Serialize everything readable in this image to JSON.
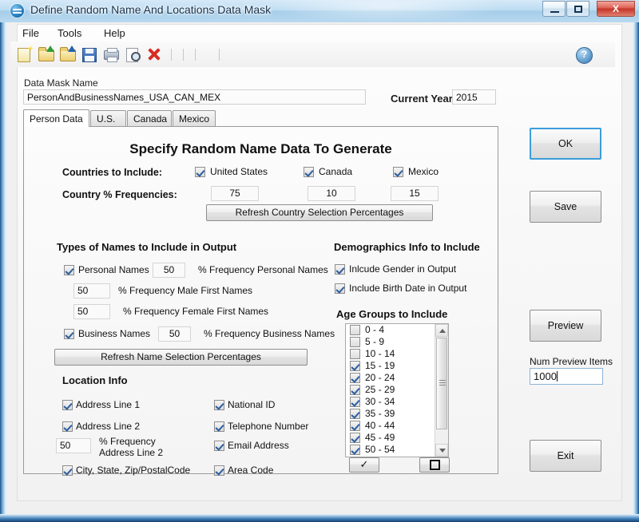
{
  "window": {
    "title": "Define Random Name And Locations Data Mask",
    "app_icon": "app-globe-icon",
    "minimize_label": "Minimize",
    "maximize_label": "Maximize",
    "close_label": "X"
  },
  "menu": [
    {
      "label": "File"
    },
    {
      "label": "Tools"
    },
    {
      "label": "Help"
    }
  ],
  "toolbar": {
    "icons": [
      {
        "name": "new-document-icon"
      },
      {
        "name": "open-folder-icon"
      },
      {
        "name": "save-as-folder-icon"
      },
      {
        "name": "save-floppy-icon"
      },
      {
        "name": "print-icon"
      },
      {
        "name": "print-preview-icon"
      },
      {
        "name": "delete-icon"
      }
    ],
    "help_glyph": "?"
  },
  "form": {
    "data_mask_name_label": "Data Mask Name",
    "data_mask_name_value": "PersonAndBusinessNames_USA_CAN_MEX",
    "current_year_label": "Current Year",
    "current_year_value": "2015"
  },
  "tabs": [
    {
      "label": "Person Data",
      "active": true
    },
    {
      "label": "U.S.",
      "active": false
    },
    {
      "label": "Canada",
      "active": false
    },
    {
      "label": "Mexico",
      "active": false
    }
  ],
  "panel": {
    "title": "Specify Random Name Data To Generate",
    "countries_label": "Countries to Include:",
    "countries": [
      {
        "label": "United States",
        "checked": true,
        "pct": "75"
      },
      {
        "label": "Canada",
        "checked": true,
        "pct": "10"
      },
      {
        "label": "Mexico",
        "checked": true,
        "pct": "15"
      }
    ],
    "frequencies_label": "Country % Frequencies:",
    "refresh_country_button": "Refresh Country Selection Percentages",
    "types_of_names_heading": "Types of Names  to Include in Output",
    "personal_names_label": "Personal Names",
    "personal_names_checked": true,
    "personal_names_pct": "50",
    "personal_names_pct_label": "% Frequency Personal Names",
    "male_pct": "50",
    "male_pct_label": "% Frequency Male First Names",
    "female_pct": "50",
    "female_pct_label": "% Frequency Female First Names",
    "business_names_label": "Business Names",
    "business_names_checked": true,
    "business_names_pct": "50",
    "business_names_pct_label": "% Frequency Business Names",
    "refresh_name_button": "Refresh Name Selection Percentages",
    "location_info_heading": "Location  Info",
    "location_left": [
      {
        "label": "Address Line 1",
        "checked": true
      },
      {
        "label": "Address Line 2",
        "checked": true
      },
      {
        "label": "City, State, Zip/PostalCode",
        "checked": true
      }
    ],
    "location_right": [
      {
        "label": "National ID",
        "checked": true
      },
      {
        "label": "Telephone Number",
        "checked": true
      },
      {
        "label": "Email Address",
        "checked": true
      },
      {
        "label": "Area Code",
        "checked": true
      }
    ],
    "address_line2_pct": "50",
    "address_line2_pct_label_1": "% Frequency",
    "address_line2_pct_label_2": "Address Line 2",
    "demographics_heading": "Demographics Info to Include",
    "demographics": [
      {
        "label": "Inlcude Gender in Output",
        "checked": true
      },
      {
        "label": "Include Birth Date in Output",
        "checked": true
      }
    ],
    "age_groups_heading": "Age Groups  to Include",
    "age_groups": [
      {
        "label": "0 - 4",
        "checked": false
      },
      {
        "label": "5 - 9",
        "checked": false
      },
      {
        "label": "10 - 14",
        "checked": false
      },
      {
        "label": "15 - 19",
        "checked": true
      },
      {
        "label": "20 - 24",
        "checked": true
      },
      {
        "label": "25 - 29",
        "checked": true
      },
      {
        "label": "30 - 34",
        "checked": true
      },
      {
        "label": "35 - 39",
        "checked": true
      },
      {
        "label": "40 - 44",
        "checked": true
      },
      {
        "label": "45 - 49",
        "checked": true
      },
      {
        "label": "50 - 54",
        "checked": true
      }
    ],
    "select_all_glyph": "✓",
    "deselect_all_glyph": "square-outline-icon"
  },
  "actions": {
    "ok": "OK",
    "save": "Save",
    "preview": "Preview",
    "exit": "Exit",
    "num_preview_items_label": "Num Preview Items",
    "num_preview_items_value": "1000"
  },
  "colors": {
    "accent": "#3c9ddb",
    "checkmark": "#2a5d9e",
    "title_text": "#17324d",
    "close_button": "#c5372a"
  }
}
